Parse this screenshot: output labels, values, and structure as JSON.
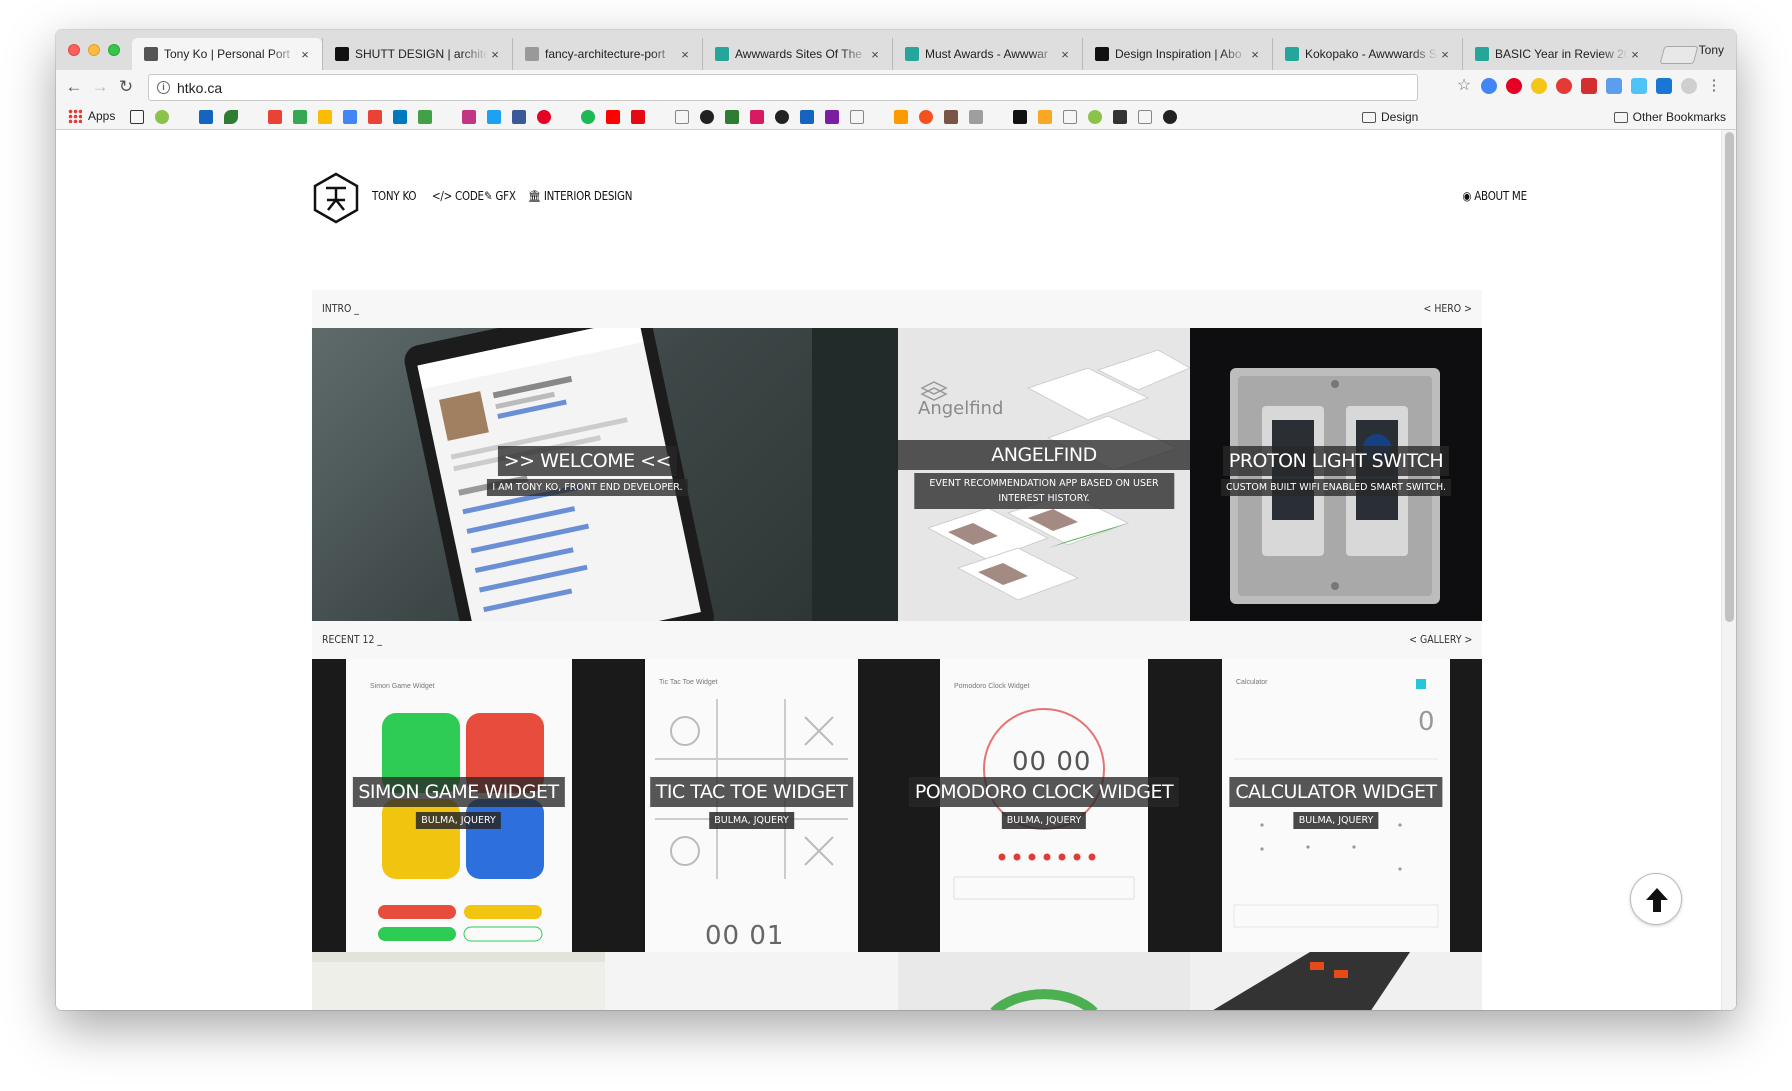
{
  "browser": {
    "tabs": [
      {
        "title": "Tony Ko | Personal Port",
        "favicon_color": "#555555",
        "active": true
      },
      {
        "title": "SHUTT DESIGN | archite",
        "favicon_color": "#111111",
        "active": false
      },
      {
        "title": "fancy-architecture-port",
        "favicon_color": "#999999",
        "active": false
      },
      {
        "title": "Awwwards Sites Of The",
        "favicon_color": "#26a69a",
        "active": false
      },
      {
        "title": "Must Awards - Awwwar",
        "favicon_color": "#26a69a",
        "active": false
      },
      {
        "title": "Design Inspiration | Abo",
        "favicon_color": "#111111",
        "active": false
      },
      {
        "title": "Kokopako - Awwwards S",
        "favicon_color": "#26a69a",
        "active": false
      },
      {
        "title": "BASIC Year in Review 20",
        "favicon_color": "#26a69a",
        "active": false
      }
    ],
    "profile_name": "Tony",
    "url": "htko.ca",
    "bookmarks": {
      "apps_label": "Apps",
      "design_folder": "Design",
      "other_folder": "Other Bookmarks"
    }
  },
  "site": {
    "nav": {
      "brand": "TONY KO",
      "code": "CODE",
      "gfx": "GFX",
      "interior": "INTERIOR DESIGN",
      "about": "ABOUT ME",
      "code_icon": "</>"
    },
    "intro_section": {
      "left": "INTRO _",
      "right": "< HERO >"
    },
    "recent_section": {
      "left": "RECENT 12 _",
      "right": "< GALLERY >"
    },
    "hero_tiles": [
      {
        "title": ">> WELCOME <<",
        "subtitle": "I AM TONY KO, FRONT END DEVELOPER."
      },
      {
        "title": "ANGELFIND",
        "subtitle": "EVENT RECOMMENDATION APP BASED ON USER INTEREST HISTORY.",
        "brand": "Angelfind"
      },
      {
        "title": "PROTON LIGHT SWITCH",
        "subtitle": "CUSTOM BUILT WIFI ENABLED SMART SWITCH."
      }
    ],
    "recent_tiles": [
      {
        "title": "SIMON GAME WIDGET",
        "tag": "BULMA, JQUERY",
        "screen_label": "Simon Game Widget"
      },
      {
        "title": "TIC TAC TOE WIDGET",
        "tag": "BULMA, JQUERY",
        "screen_label": "Tic Tac Toe Widget",
        "score": "00 01"
      },
      {
        "title": "POMODORO CLOCK WIDGET",
        "tag": "BULMA, JQUERY",
        "screen_label": "Pomodoro Clock Widget",
        "timer": "00 00"
      },
      {
        "title": "CALCULATOR WIDGET",
        "tag": "BULMA, JQUERY",
        "screen_label": "Calculator",
        "display": "0"
      }
    ]
  }
}
